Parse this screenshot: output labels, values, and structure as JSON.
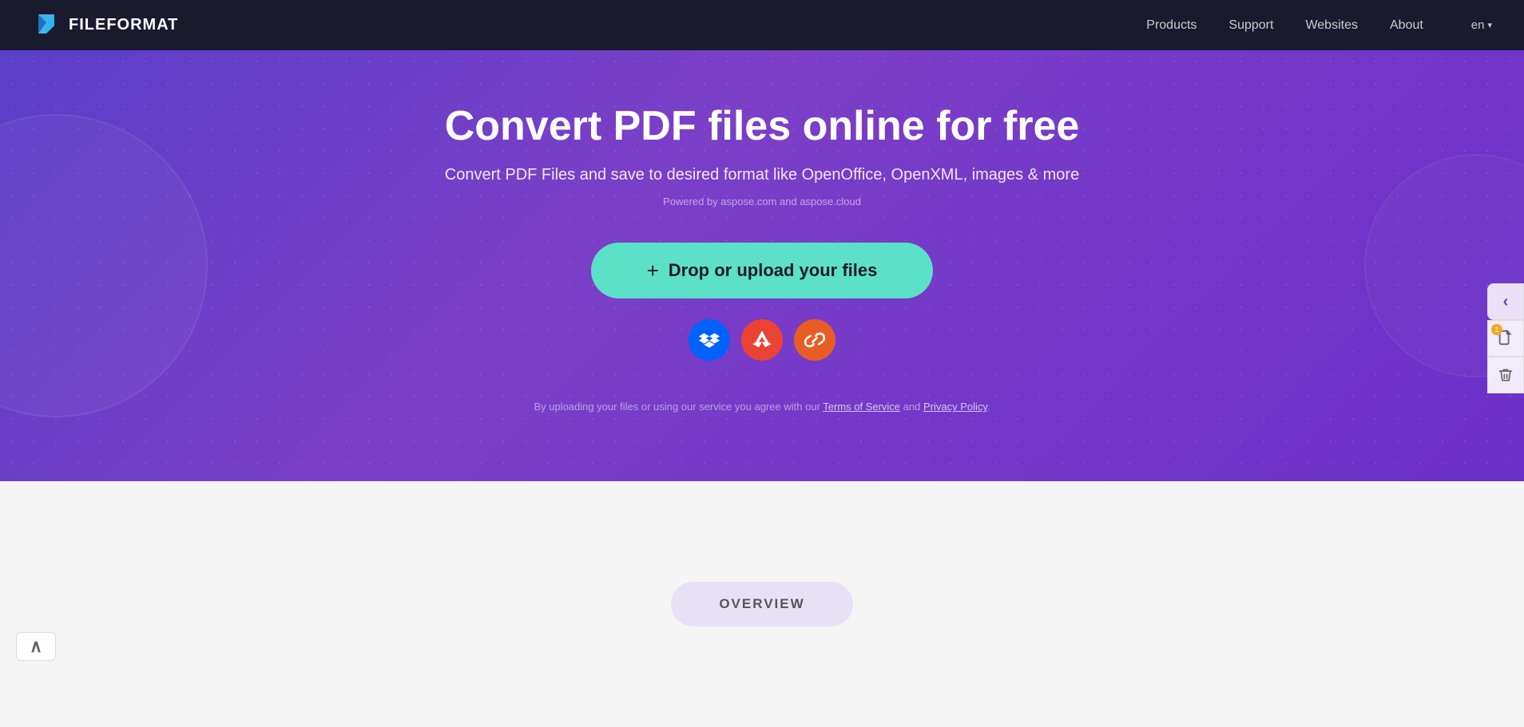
{
  "navbar": {
    "logo_text": "FILEFORMAT",
    "nav_items": [
      {
        "id": "products",
        "label": "Products"
      },
      {
        "id": "support",
        "label": "Support"
      },
      {
        "id": "websites",
        "label": "Websites"
      },
      {
        "id": "about",
        "label": "About"
      }
    ],
    "lang": "en",
    "lang_chevron": "▾"
  },
  "hero": {
    "title": "Convert PDF files online for free",
    "subtitle": "Convert PDF Files and save to desired format like OpenOffice, OpenXML, images & more",
    "powered": "Powered by aspose.com and aspose.cloud",
    "upload_btn_label": "Drop or upload your files",
    "upload_btn_plus": "+",
    "cloud_icons": [
      {
        "id": "dropbox",
        "icon": "dropbox",
        "color": "#0061ff",
        "label": "Dropbox"
      },
      {
        "id": "drive",
        "icon": "drive",
        "color": "#ea4335",
        "label": "Google Drive"
      },
      {
        "id": "link",
        "icon": "link",
        "color": "#e85d26",
        "label": "URL Link"
      }
    ],
    "terms_text": "By uploading your files or using our service you agree with our ",
    "terms_tos": "Terms of Service",
    "terms_and": " and ",
    "terms_pp": "Privacy Policy",
    "terms_period": "."
  },
  "overview": {
    "btn_label": "OVERVIEW"
  },
  "sidebar": {
    "chevron": "‹",
    "notification_count": "1",
    "copy_icon": "📋",
    "delete_icon": "🗑"
  },
  "scroll_up": {
    "icon": "∧"
  },
  "colors": {
    "hero_bg": "#7b3fc8",
    "hero_bg2": "#5b3fc8",
    "upload_btn": "#5de0c8",
    "navbar_bg": "#1a1a2e"
  }
}
